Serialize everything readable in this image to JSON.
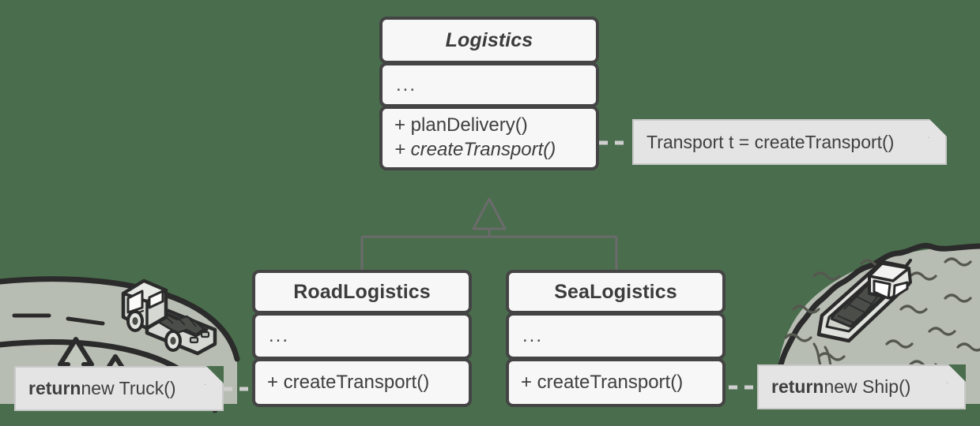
{
  "diagram": {
    "title": "Factory Method pattern UML class diagram",
    "background_color": "#4a6e4d",
    "box_fill_color": "#f7f7f7",
    "box_border_color": "#444444",
    "note_fill_color": "#e4e4e4",
    "note_border_color": "#c9c9c9",
    "connector_color": "#6b6b6b"
  },
  "classes": [
    {
      "id": "logistics",
      "name": "Logistics",
      "abstract": true,
      "attributes": "...",
      "operations": [
        {
          "text": "+ planDelivery()",
          "abstract": false
        },
        {
          "text": "+ createTransport()",
          "abstract": true
        }
      ]
    },
    {
      "id": "road_logistics",
      "name": "RoadLogistics",
      "abstract": false,
      "attributes": "...",
      "operations": [
        {
          "text": "+ createTransport()",
          "abstract": false
        }
      ]
    },
    {
      "id": "sea_logistics",
      "name": "SeaLogistics",
      "abstract": false,
      "attributes": "...",
      "operations": [
        {
          "text": "+ createTransport()",
          "abstract": false
        }
      ]
    }
  ],
  "notes": [
    {
      "id": "note_transport",
      "text": "Transport t = createTransport()",
      "bold_prefix": "",
      "rest": "Transport t = createTransport()"
    },
    {
      "id": "note_truck",
      "bold_prefix": "return",
      "rest": " new Truck()"
    },
    {
      "id": "note_ship",
      "bold_prefix": "return",
      "rest": " new Ship()"
    }
  ],
  "illustrations": [
    {
      "id": "truck-illustration",
      "label": "truck on road with trees"
    },
    {
      "id": "ship-illustration",
      "label": "cargo boat on water"
    }
  ],
  "relationships": [
    {
      "type": "generalization",
      "from": "RoadLogistics",
      "to": "Logistics"
    },
    {
      "type": "generalization",
      "from": "SeaLogistics",
      "to": "Logistics"
    },
    {
      "type": "note-link",
      "from": "note_transport",
      "to": "Logistics.planDelivery()"
    },
    {
      "type": "note-link",
      "from": "note_truck",
      "to": "RoadLogistics.createTransport()"
    },
    {
      "type": "note-link",
      "from": "note_ship",
      "to": "SeaLogistics.createTransport()"
    }
  ]
}
